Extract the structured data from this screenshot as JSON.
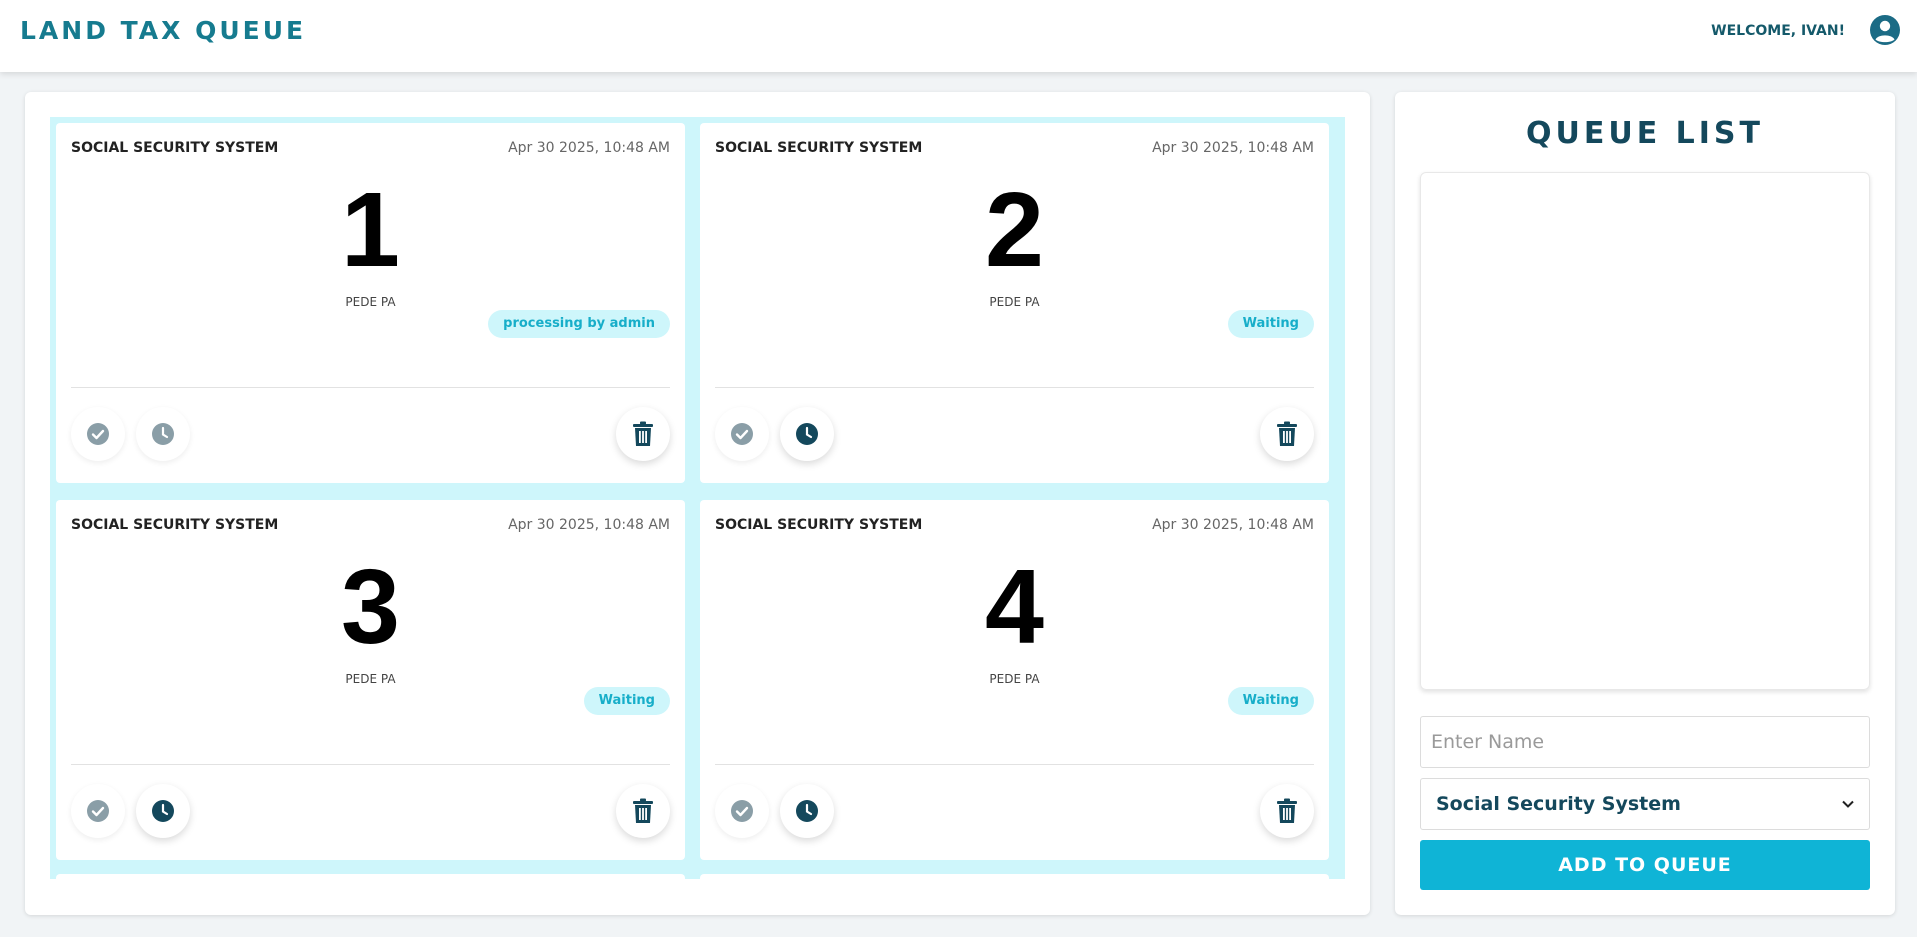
{
  "header": {
    "title": "LAND TAX QUEUE",
    "welcome": "WELCOME, IVAN!",
    "avatar_icon": "user-circle-icon"
  },
  "colors": {
    "brand": "#167b8f",
    "dark": "#14485c",
    "accent": "#0fb4d6",
    "grid_bg": "#cef6fb",
    "badge_text": "#17aec9",
    "icon_muted": "#8a9ea7"
  },
  "queue_cards": [
    {
      "office": "SOCIAL SECURITY SYSTEM",
      "timestamp": "Apr 30 2025, 10:48 AM",
      "number": "1",
      "name": "PEDE PA",
      "status": "processing by admin"
    },
    {
      "office": "SOCIAL SECURITY SYSTEM",
      "timestamp": "Apr 30 2025, 10:48 AM",
      "number": "2",
      "name": "PEDE PA",
      "status": "Waiting"
    },
    {
      "office": "SOCIAL SECURITY SYSTEM",
      "timestamp": "Apr 30 2025, 10:48 AM",
      "number": "3",
      "name": "PEDE PA",
      "status": "Waiting"
    },
    {
      "office": "SOCIAL SECURITY SYSTEM",
      "timestamp": "Apr 30 2025, 10:48 AM",
      "number": "4",
      "name": "PEDE PA",
      "status": "Waiting"
    }
  ],
  "card_icons": {
    "complete": "check-circle-icon",
    "hold": "clock-icon",
    "delete": "trash-icon"
  },
  "sidebar": {
    "title": "QUEUE LIST",
    "name_placeholder": "Enter Name",
    "office_selected": "Social Security System",
    "add_button": "ADD TO QUEUE"
  }
}
